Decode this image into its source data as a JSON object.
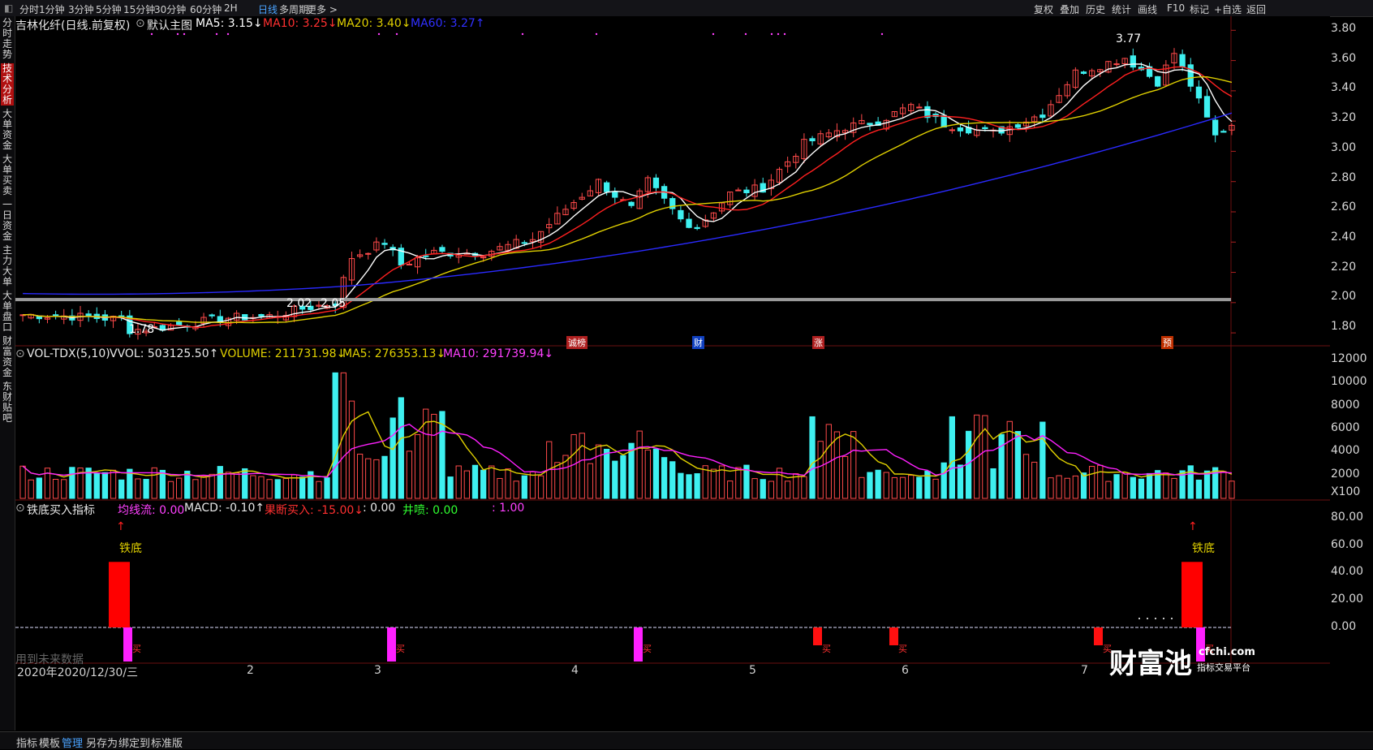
{
  "toolbar": {
    "periods": [
      "分时",
      "1分钟",
      "3分钟",
      "5分钟",
      "15分钟",
      "30分钟",
      "60分钟",
      "2H",
      "日线",
      "多周期",
      "更多 >"
    ],
    "active_period": "日线",
    "right_tools": [
      "复权",
      "叠加",
      "历史",
      "统计",
      "画线",
      "F10",
      "标记",
      "+自选",
      "返回"
    ]
  },
  "side_tabs": [
    "分时走势",
    "技术分析",
    "大单资金",
    "大单买卖",
    "一日资金",
    "主力大单",
    "大单盘口",
    "财富资金",
    "东财贴吧"
  ],
  "side_active": "技术分析",
  "main_legend": {
    "title": "吉林化纤(日线.前复权)",
    "mode": "默认主图",
    "ma5": "MA5: 3.15↓",
    "ma10": "MA10: 3.25↓",
    "ma20": "MA20: 3.40↓",
    "ma60": "MA60: 3.27↑"
  },
  "vol_legend": {
    "name": "VOL-TDX(5,10)",
    "vvol": "VVOL: 503125.50↑",
    "volume": "VOLUME: 211731.98↓",
    "ma5": "MA5: 276353.13↓",
    "ma10": "MA10: 291739.94↓"
  },
  "ind_legend": {
    "name": "铁底买入指标",
    "jxl": "均线流: 0.00",
    "macd": "MACD: -0.10↑",
    "gdmr": "果断买入: -15.00↓",
    "blank": ": 0.00",
    "jp": "井喷: 0.00",
    "last": ": 1.00"
  },
  "price_axis": [
    "3.80",
    "3.60",
    "3.40",
    "3.20",
    "3.00",
    "2.80",
    "2.60",
    "2.40",
    "2.20",
    "2.00",
    "1.80"
  ],
  "vol_axis": [
    "12000",
    "10000",
    "8000",
    "6000",
    "4000",
    "2000",
    "X100"
  ],
  "ind_axis": [
    "80.00",
    "60.00",
    "40.00",
    "20.00",
    "0.00"
  ],
  "annotations": {
    "high": "3.77",
    "low": "1.78",
    "s1": "2.02",
    "s2": "2.05",
    "tie_di": "铁底",
    "buy": "买"
  },
  "event_tags": [
    "诚榜",
    "财",
    "涨",
    "预"
  ],
  "x_labels": [
    "2",
    "3",
    "4",
    "5",
    "6",
    "7"
  ],
  "date_label": "2020年2020/12/30/三",
  "future_label": "用到未来数据",
  "watermark": {
    "brand": "财富池",
    "site": "cfchi.com",
    "sub": "指标交易平台"
  },
  "bottom_tools": [
    "指标",
    "模板",
    "管理",
    "另存为",
    "绑定到",
    "标准版"
  ],
  "colors": {
    "up": "#ff4a4a",
    "down": "#3ef0f0",
    "ma5": "#ffffff",
    "ma10": "#ff2020",
    "ma20": "#e0d000",
    "ma60": "#2a2aff",
    "magenta": "#ff20ff"
  }
}
